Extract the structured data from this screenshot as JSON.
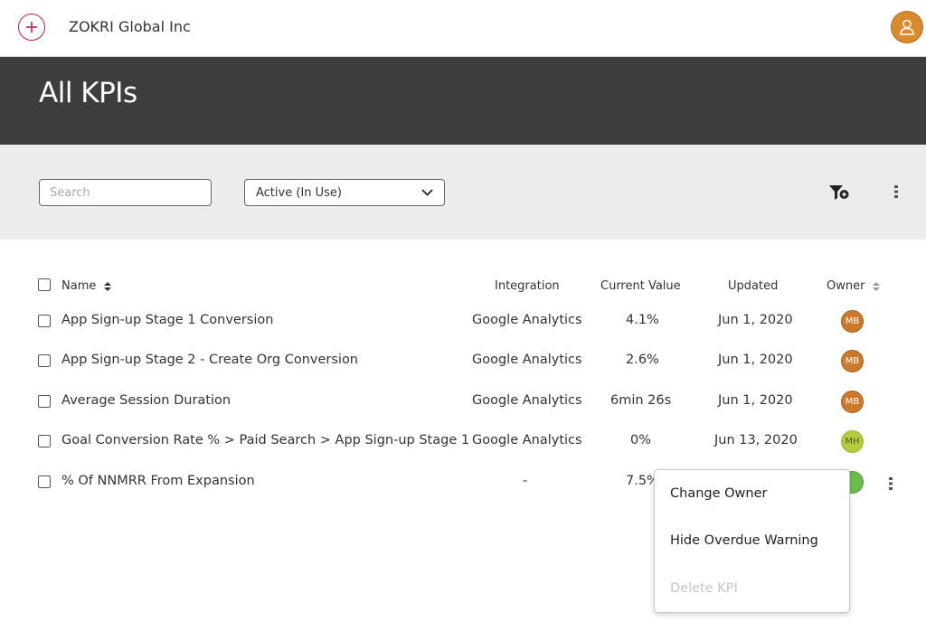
{
  "header": {
    "org_name": "ZOKRI Global Inc",
    "icons": {
      "add": "plus-circle-icon",
      "user": "user-avatar-icon"
    },
    "accent_color": "#c2185b",
    "avatar_color": "#d98a2b"
  },
  "page": {
    "title": "All KPIs"
  },
  "toolbar": {
    "search_placeholder": "Search",
    "search_value": "",
    "status_filter": "Active (In Use)",
    "icons": {
      "filter": "filter-add-icon",
      "more": "more-vertical-icon"
    }
  },
  "table": {
    "columns": {
      "name": "Name",
      "integration": "Integration",
      "current_value": "Current Value",
      "updated": "Updated",
      "owner": "Owner"
    },
    "rows": [
      {
        "name": "App Sign-up Stage 1 Conversion",
        "integration": "Google Analytics",
        "value": "4.1%",
        "updated": "Jun 1, 2020",
        "owner": "MB"
      },
      {
        "name": "App Sign-up Stage 2 - Create Org Conversion",
        "integration": "Google Analytics",
        "value": "2.6%",
        "updated": "Jun 1, 2020",
        "owner": "MB"
      },
      {
        "name": "Average Session Duration",
        "integration": "Google Analytics",
        "value": "6min 26s",
        "updated": "Jun 1, 2020",
        "owner": "MB"
      },
      {
        "name": "Goal Conversion Rate % > Paid Search > App Sign-up Stage 1",
        "integration": "Google Analytics",
        "value": "0%",
        "updated": "Jun 13, 2020",
        "owner": "MH"
      },
      {
        "name": "% Of NNMRR From Expansion",
        "integration": "-",
        "value": "7.5%",
        "updated": "",
        "owner": ""
      }
    ]
  },
  "context_menu": {
    "items": [
      {
        "label": "Change Owner",
        "enabled": true
      },
      {
        "label": "Hide Overdue Warning",
        "enabled": true
      },
      {
        "label": "Delete KPI",
        "enabled": false
      }
    ]
  }
}
